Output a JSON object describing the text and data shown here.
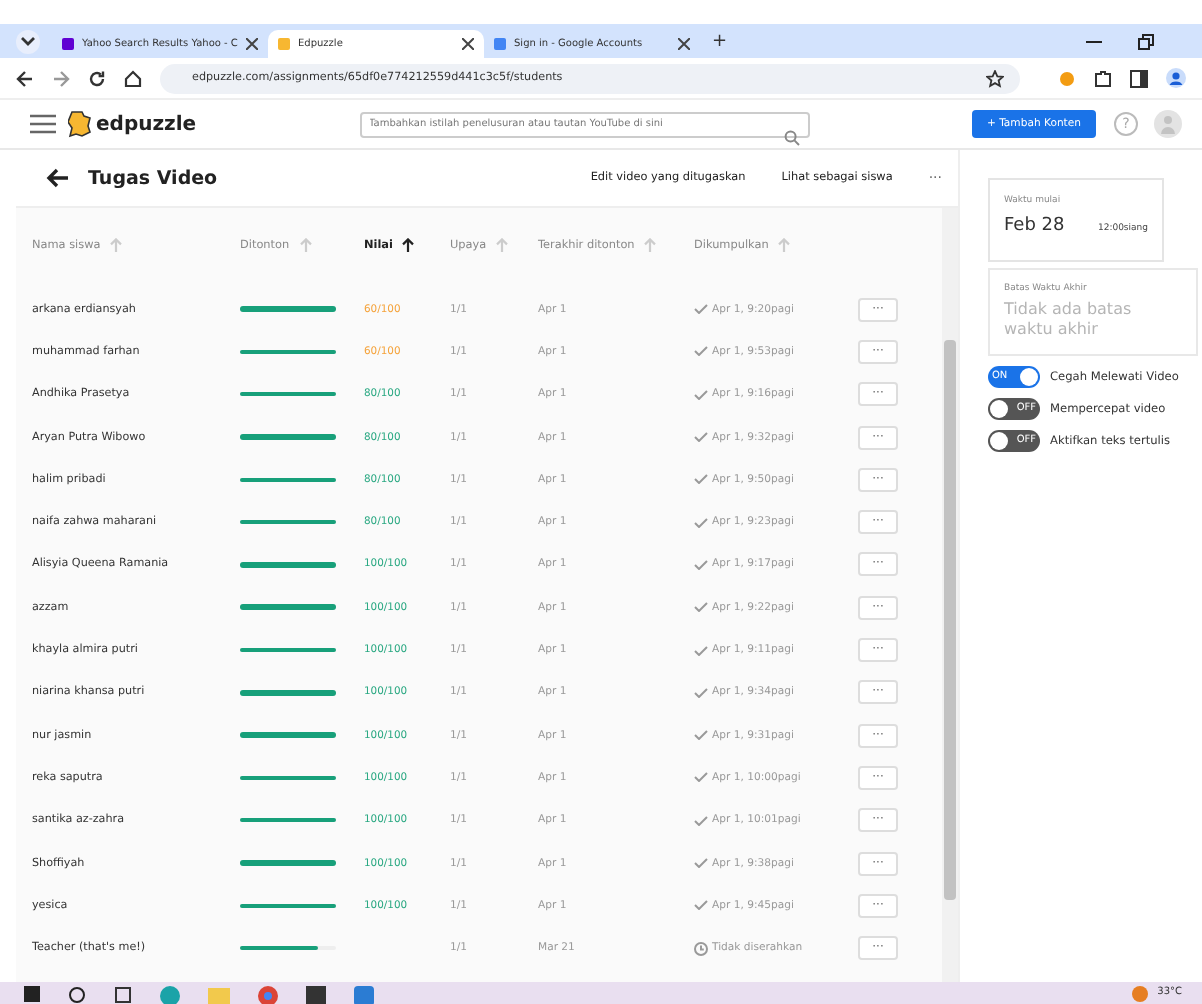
{
  "browser": {
    "tabs": [
      {
        "title": "Yahoo Search Results Yahoo - C",
        "selected": false
      },
      {
        "title": "Edpuzzle",
        "selected": true
      },
      {
        "title": "Sign in - Google Accounts",
        "selected": false
      }
    ],
    "new_tab": "+",
    "url": "edpuzzle.com/assignments/65df0e774212559d441c3c5f/students"
  },
  "app": {
    "logo": "edpuzzle",
    "search": {
      "placeholder": "Tambahkan istilah penelusuran atau tautan YouTube di sini"
    },
    "add_button": "+ Tambah Konten",
    "help": "?"
  },
  "page": {
    "title": "Tugas Video",
    "actions": [
      "Edit video yang ditugaskan",
      "Lihat sebagai siswa"
    ],
    "more": "···"
  },
  "table": {
    "columns": [
      {
        "label": "Nama siswa",
        "sorted": false
      },
      {
        "label": "Ditonton",
        "sorted": false
      },
      {
        "label": "Nilai",
        "sorted": true
      },
      {
        "label": "Upaya",
        "sorted": false
      },
      {
        "label": "Terakhir ditonton",
        "sorted": false
      },
      {
        "label": "Dikumpulkan",
        "sorted": false
      }
    ],
    "rows": [
      {
        "name": "arkana erdiansyah",
        "level": 1,
        "grade": "60/100",
        "color": "#f5a33b",
        "attempts": "1/1",
        "last": "Apr 1",
        "kind": "submitted",
        "submitted": "Apr 1, 9:20pagi"
      },
      {
        "name": "muhammad farhan",
        "level": 1,
        "grade": "60/100",
        "color": "#f5a33b",
        "attempts": "1/1",
        "last": "Apr 1",
        "kind": "submitted",
        "submitted": "Apr 1, 9:53pagi"
      },
      {
        "name": "Andhika Prasetya",
        "level": 1,
        "grade": "80/100",
        "color": "#2aa882",
        "attempts": "1/1",
        "last": "Apr 1",
        "kind": "submitted",
        "submitted": "Apr 1, 9:16pagi"
      },
      {
        "name": "Aryan Putra Wibowo",
        "level": 1,
        "grade": "80/100",
        "color": "#2aa882",
        "attempts": "1/1",
        "last": "Apr 1",
        "kind": "submitted",
        "submitted": "Apr 1, 9:32pagi"
      },
      {
        "name": "halim pribadi",
        "level": 1,
        "grade": "80/100",
        "color": "#2aa882",
        "attempts": "1/1",
        "last": "Apr 1",
        "kind": "submitted",
        "submitted": "Apr 1, 9:50pagi"
      },
      {
        "name": "naifa zahwa maharani",
        "level": 1,
        "grade": "80/100",
        "color": "#2aa882",
        "attempts": "1/1",
        "last": "Apr 1",
        "kind": "submitted",
        "submitted": "Apr 1, 9:23pagi"
      },
      {
        "name": "Alisyia Queena Ramania",
        "level": 1,
        "grade": "100/100",
        "color": "#2aa882",
        "attempts": "1/1",
        "last": "Apr 1",
        "kind": "submitted",
        "submitted": "Apr 1, 9:17pagi"
      },
      {
        "name": "azzam",
        "level": 1,
        "grade": "100/100",
        "color": "#2aa882",
        "attempts": "1/1",
        "last": "Apr 1",
        "kind": "submitted",
        "submitted": "Apr 1, 9:22pagi"
      },
      {
        "name": "khayla almira putri",
        "level": 1,
        "grade": "100/100",
        "color": "#2aa882",
        "attempts": "1/1",
        "last": "Apr 1",
        "kind": "submitted",
        "submitted": "Apr 1, 9:11pagi"
      },
      {
        "name": "niarina khansa putri",
        "level": 1,
        "grade": "100/100",
        "color": "#2aa882",
        "attempts": "1/1",
        "last": "Apr 1",
        "kind": "submitted",
        "submitted": "Apr 1, 9:34pagi"
      },
      {
        "name": "nur jasmin",
        "level": 1,
        "grade": "100/100",
        "color": "#2aa882",
        "attempts": "1/1",
        "last": "Apr 1",
        "kind": "submitted",
        "submitted": "Apr 1, 9:31pagi"
      },
      {
        "name": "reka saputra",
        "level": 1,
        "grade": "100/100",
        "color": "#2aa882",
        "attempts": "1/1",
        "last": "Apr 1",
        "kind": "submitted",
        "submitted": "Apr 1, 10:00pagi"
      },
      {
        "name": "santika az-zahra",
        "level": 1,
        "grade": "100/100",
        "color": "#2aa882",
        "attempts": "1/1",
        "last": "Apr 1",
        "kind": "submitted",
        "submitted": "Apr 1, 10:01pagi"
      },
      {
        "name": "Shoffiyah",
        "level": 1,
        "grade": "100/100",
        "color": "#2aa882",
        "attempts": "1/1",
        "last": "Apr 1",
        "kind": "submitted",
        "submitted": "Apr 1, 9:38pagi"
      },
      {
        "name": "yesica",
        "level": 1,
        "grade": "100/100",
        "color": "#2aa882",
        "attempts": "1/1",
        "last": "Apr 1",
        "kind": "submitted",
        "submitted": "Apr 1, 9:45pagi"
      },
      {
        "name": "Teacher (that's me!)",
        "level": 0.82,
        "attempts": "1/1",
        "last": "Mar 21",
        "kind": "not_submitted",
        "submitted": "Tidak diserahkan"
      }
    ],
    "row_menu": "···"
  },
  "sidebar": {
    "start": {
      "label": "Waktu mulai",
      "date": "Feb 28",
      "time": "12:00siang"
    },
    "due": {
      "label": "Batas Waktu Akhir",
      "placeholder": "Tidak ada batas waktu akhir"
    },
    "toggles": [
      {
        "label": "Cegah Melewati Video",
        "on": true,
        "text": "ON"
      },
      {
        "label": "Mempercepat video",
        "on": false,
        "text": "OFF"
      },
      {
        "label": "Aktifkan teks tertulis",
        "on": false,
        "text": "OFF"
      }
    ]
  },
  "taskbar": {
    "weather": "33°C"
  }
}
